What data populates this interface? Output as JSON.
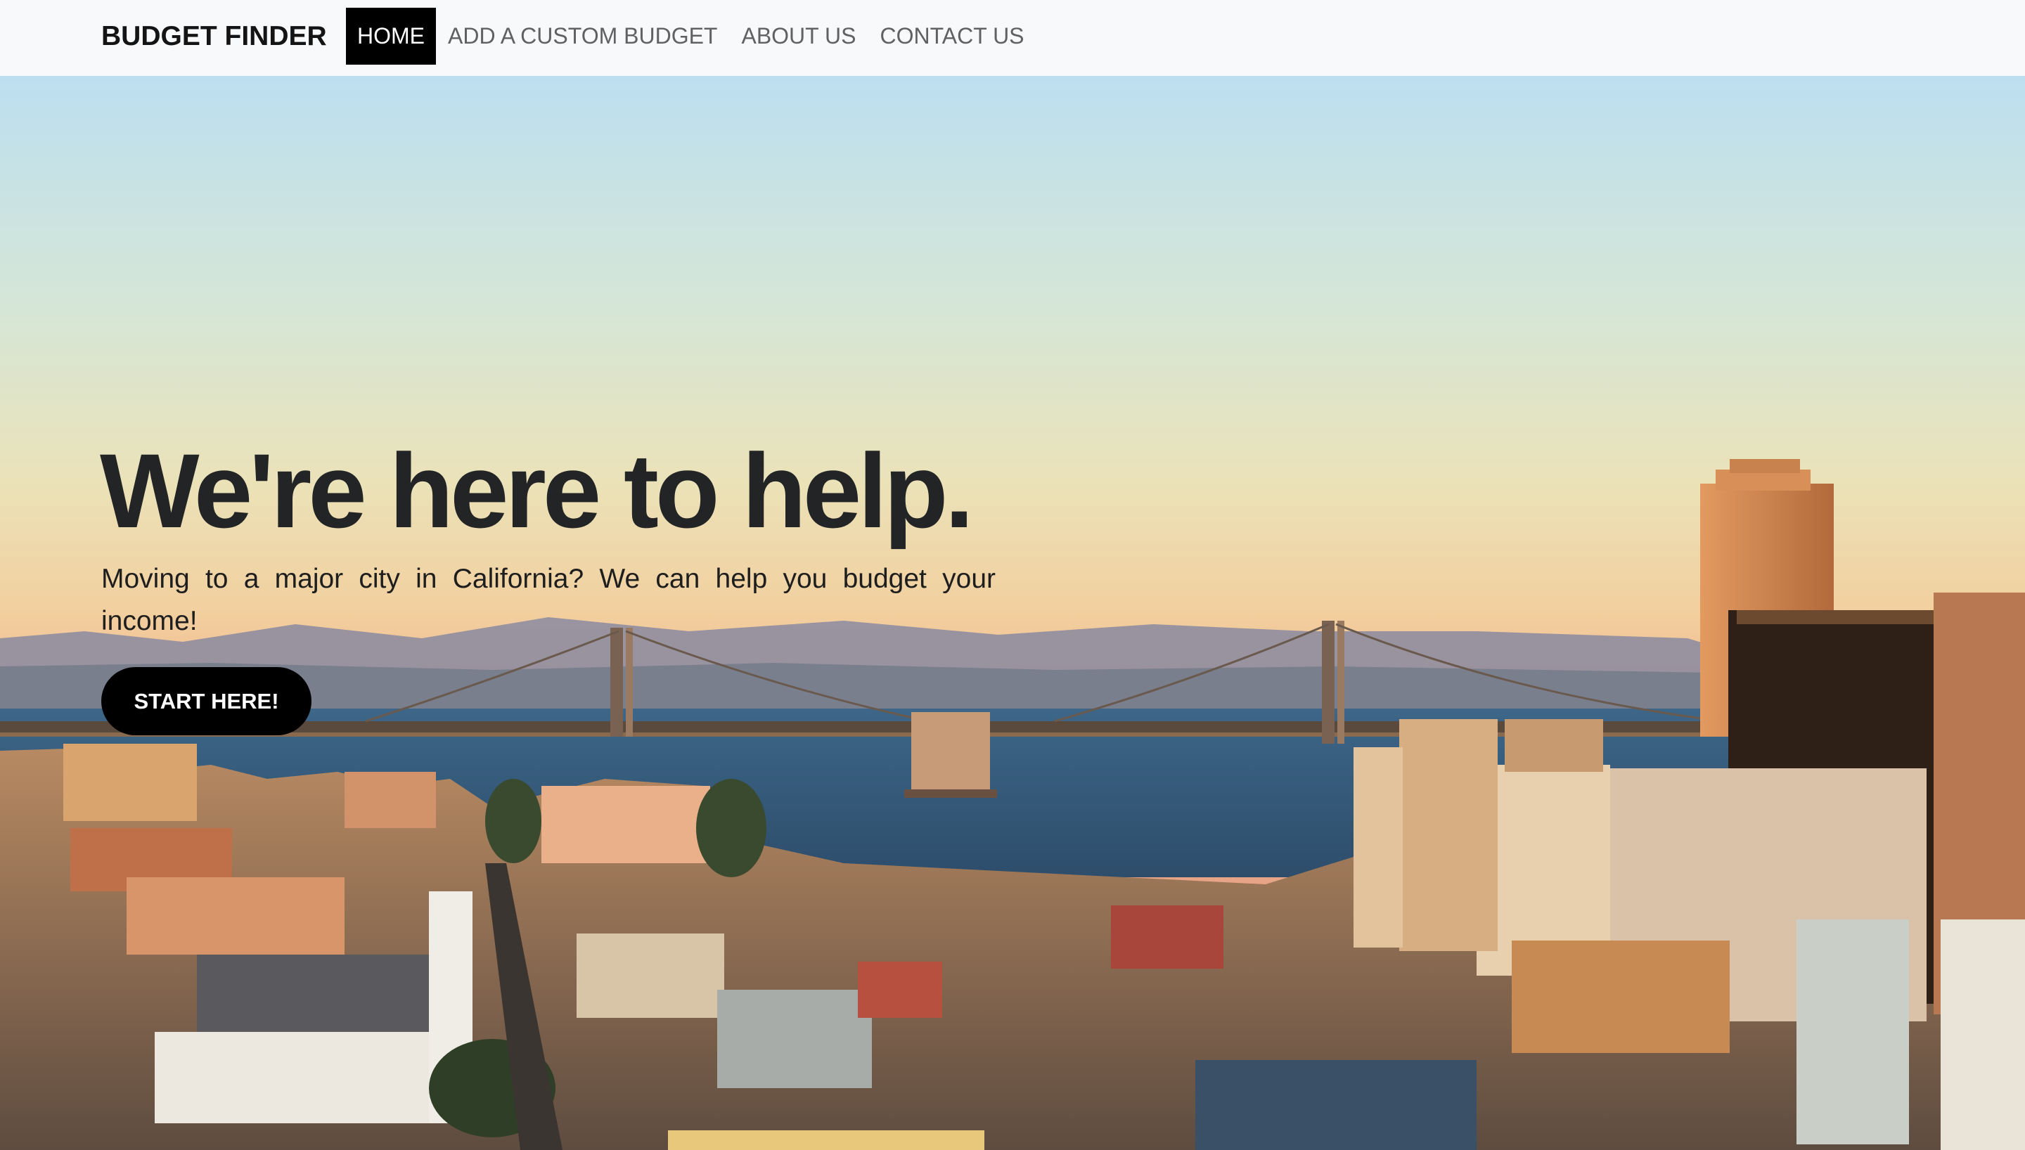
{
  "nav": {
    "brand": "BUDGET FINDER",
    "links": [
      {
        "label": "HOME",
        "active": true
      },
      {
        "label": "ADD A CUSTOM BUDGET",
        "active": false
      },
      {
        "label": "ABOUT US",
        "active": false
      },
      {
        "label": "CONTACT US",
        "active": false
      }
    ]
  },
  "hero": {
    "title": "We're here to help.",
    "subtitle": "Moving to a major city in California? We can help you budget your income!",
    "cta_label": "START HERE!",
    "background_image": "san-francisco-bay-bridge-sunset-photo"
  },
  "colors": {
    "navbar_bg": "#f8f9fa",
    "active_nav_bg": "#000000",
    "button_bg": "#000000",
    "title_text": "#222426"
  }
}
